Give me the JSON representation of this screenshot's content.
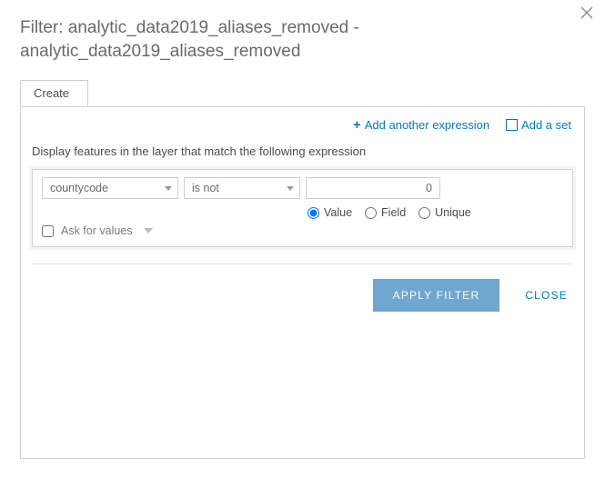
{
  "dialog": {
    "title": "Filter: analytic_data2019_aliases_removed - analytic_data2019_aliases_removed"
  },
  "tabs": {
    "create": "Create"
  },
  "toolbar": {
    "add_expression": "Add another expression",
    "add_set": "Add a set"
  },
  "description": "Display features in the layer that match the following expression",
  "expression": {
    "field": "countycode",
    "operator": "is not",
    "value": "0",
    "value_type_options": {
      "value": "Value",
      "field": "Field",
      "unique": "Unique"
    },
    "ask_for_values": "Ask for values"
  },
  "footer": {
    "apply": "APPLY FILTER",
    "close": "CLOSE"
  }
}
